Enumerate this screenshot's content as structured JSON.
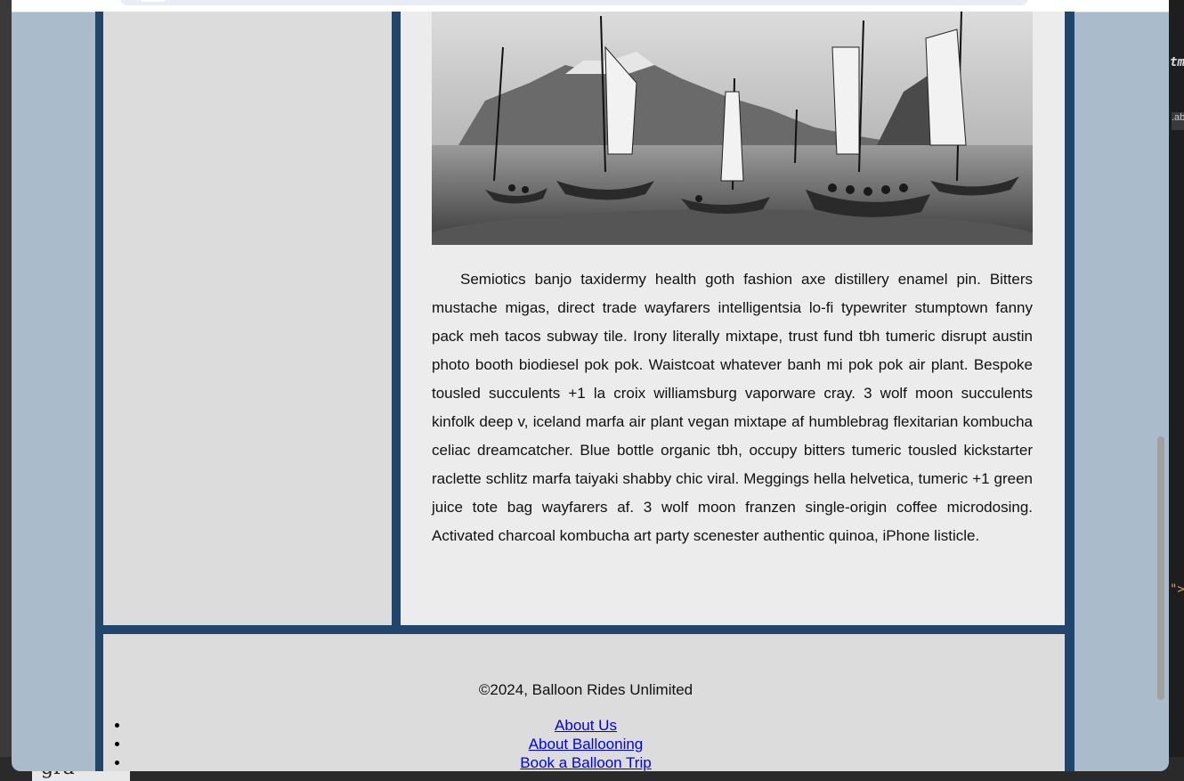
{
  "background": {
    "bottom_left_text": "gra",
    "right_code_italic": "tml",
    "right_code_tag": ".ab",
    "right_code_quote": "\">"
  },
  "article": {
    "paragraph": "Semiotics banjo taxidermy health goth fashion axe distillery enamel pin. Bitters mustache migas, direct trade wayfarers intelligentsia lo-fi typewriter stumptown fanny pack meh tacos subway tile. Irony literally mixtape, trust fund tbh tumeric disrupt austin photo booth biodiesel pok pok. Waistcoat whatever banh mi pok pok air plant. Bespoke tousled succulents +1 la croix williamsburg vaporware cray. 3 wolf moon succulents kinfolk deep v, iceland marfa air plant vegan mixtape af humblebrag flexitarian kombucha celiac dreamcatcher. Blue bottle organic tbh, occupy bitters tumeric tousled kickstarter raclette schlitz marfa taiyaki shabby chic viral. Meggings hella helvetica, tumeric +1 green juice tote bag wayfarers af. 3 wolf moon franzen single-origin coffee microdosing. Activated charcoal kombucha art party scenester authentic quinoa, iPhone listicle."
  },
  "footer": {
    "copyright": "©2024, Balloon Rides Unlimited",
    "links": [
      {
        "label": "About Us"
      },
      {
        "label": "About Ballooning"
      },
      {
        "label": "Book a Balloon Trip"
      }
    ]
  },
  "colors": {
    "page_bg": "#aabbcc",
    "frame": "#22466b",
    "sidebar": "#dcdcdd",
    "main": "#ececec",
    "link": "#0000ee"
  }
}
